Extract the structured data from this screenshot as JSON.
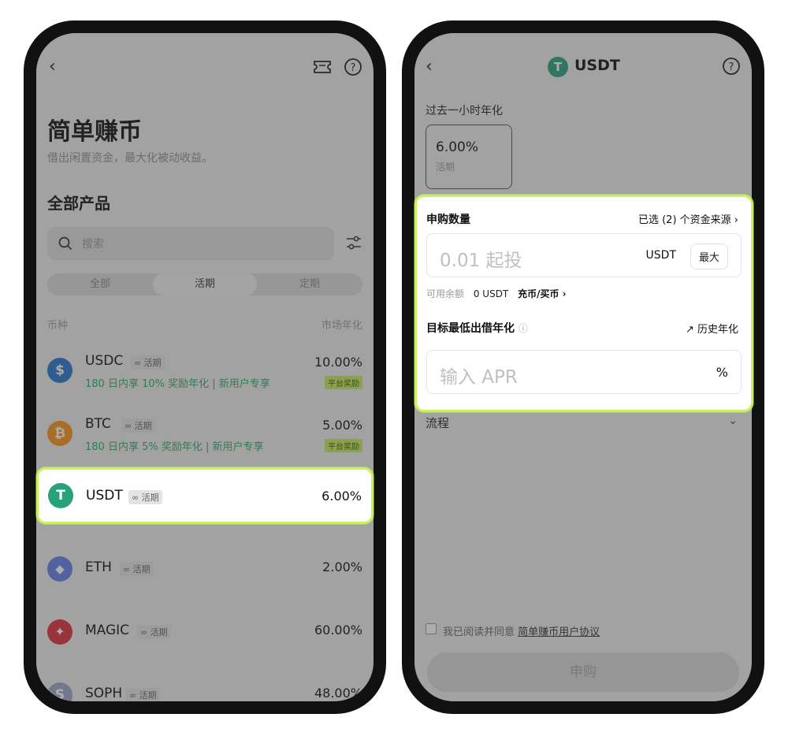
{
  "left": {
    "page_title": "简单赚币",
    "page_subtitle": "借出闲置资金，最大化被动收益。",
    "section_title": "全部产品",
    "search_placeholder": "搜索",
    "tabs": [
      "全部",
      "活期",
      "定期"
    ],
    "col_coin": "币种",
    "col_rate": "市场年化",
    "items": [
      {
        "name": "USDC",
        "tag": "活期",
        "rate": "10.00%",
        "promo": "180 日内享 10% 奖励年化 | 新用户专享",
        "badge": "平台奖励",
        "color": "#2775ca",
        "glyph": "$"
      },
      {
        "name": "BTC",
        "tag": "活期",
        "rate": "5.00%",
        "promo": "180 日内享 5% 奖励年化 | 新用户专享",
        "badge": "平台奖励",
        "color": "#f7931a",
        "glyph": "₿"
      },
      {
        "name": "USDT",
        "tag": "活期",
        "rate": "6.00%",
        "color": "#26a17b",
        "glyph": "T"
      },
      {
        "name": "ETH",
        "tag": "活期",
        "rate": "2.00%",
        "color": "#627eea",
        "glyph": "◆"
      },
      {
        "name": "MAGIC",
        "tag": "活期",
        "rate": "60.00%",
        "color": "#dc2f3d",
        "glyph": "✦"
      },
      {
        "name": "SOPH",
        "tag": "活期",
        "rate": "48.00%",
        "color": "#9aa6c4",
        "glyph": "S"
      }
    ]
  },
  "right": {
    "title": "USDT",
    "title_glyph": "T",
    "last_hour_label": "过去一小时年化",
    "card_rate": "6.00%",
    "card_term": "活期",
    "subscribe_label": "申购数量",
    "selected_sources": "已选 (2) 个资金来源",
    "amount_placeholder": "0.01 起投",
    "currency": "USDT",
    "max_label": "最大",
    "available_label": "可用余额",
    "available_value": "0 USDT",
    "deposit_link": "充币/买币",
    "target_label": "目标最低出借年化",
    "history_label": "历史年化",
    "apr_placeholder": "输入 APR",
    "percent": "%",
    "process_label": "流程",
    "agree_prefix": "我已阅读并同意",
    "agree_link": "简单赚币用户协议",
    "submit_label": "申购"
  },
  "colors": {
    "highlight": "#c8f15d",
    "promo_text": "#2ea96b",
    "badge_bg": "#c4eb58"
  }
}
